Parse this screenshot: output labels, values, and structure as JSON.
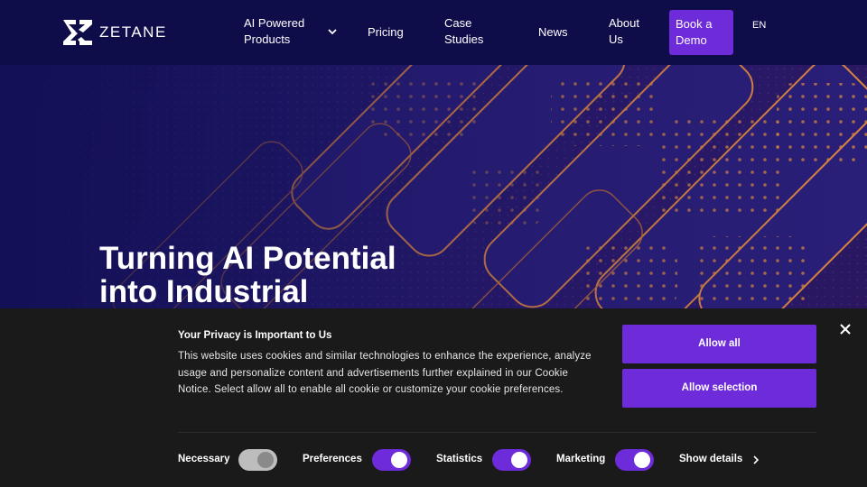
{
  "nav": {
    "logo_text": "ZETANE",
    "items": [
      {
        "label": "AI Powered\nProducts"
      },
      {
        "label": "Pricing"
      },
      {
        "label": "Case\nStudies"
      },
      {
        "label": "News"
      },
      {
        "label": "About\nUs"
      }
    ],
    "cta_label": "Book a\nDemo",
    "language": "EN"
  },
  "hero": {
    "title": "Turning AI Potential into Industrial"
  },
  "cookie": {
    "title": "Your Privacy is Important to Us",
    "body": "This website uses cookies and similar technologies to enhance the experience, analyze usage and personalize content and advertisements further explained in our Cookie Notice. Select allow all to enable all cookie or customize your cookie preferences.",
    "allow_all_label": "Allow all",
    "allow_selection_label": "Allow selection",
    "toggles": [
      {
        "label": "Necessary",
        "checked": true,
        "disabled": true
      },
      {
        "label": "Preferences",
        "checked": true
      },
      {
        "label": "Statistics",
        "checked": true
      },
      {
        "label": "Marketing",
        "checked": true
      }
    ],
    "show_details_label": "Show details"
  },
  "colors": {
    "nav_bg": "#0f0c4a",
    "accent": "#6d2bd9",
    "cookie_bg": "#1a1a1a",
    "hero_orange": "#d9853e"
  },
  "icons": [
    "zetane-logo-icon",
    "chevron-down-icon",
    "close-icon",
    "chevron-right-icon"
  ]
}
